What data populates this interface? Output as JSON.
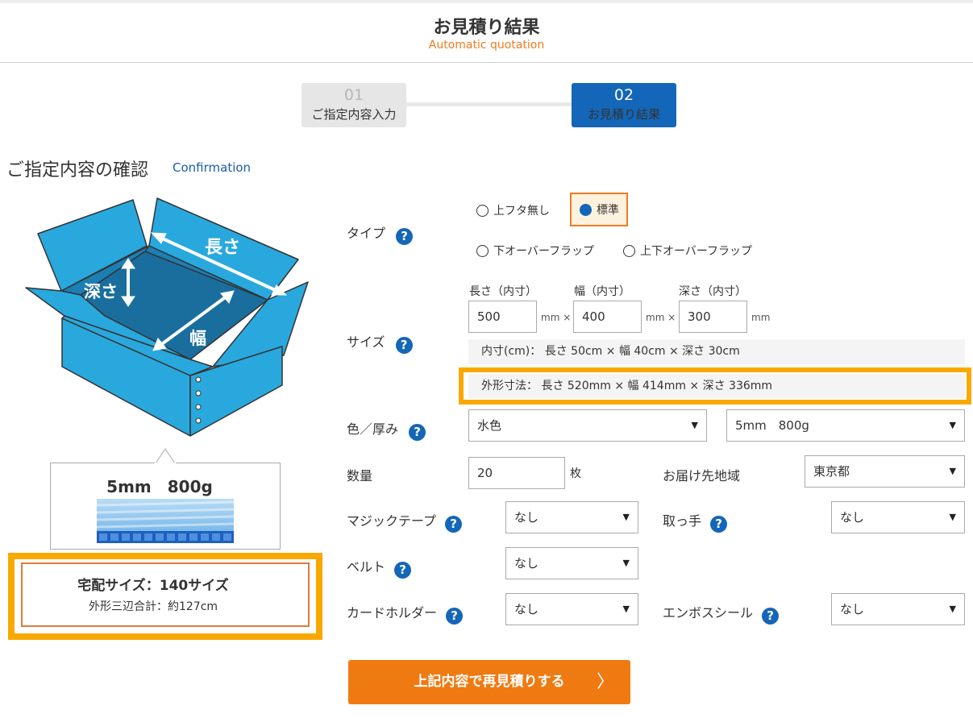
{
  "header": {
    "title": "お見積り結果",
    "subtitle": "Automatic quotation"
  },
  "steps": [
    {
      "num": "01",
      "label": "ご指定内容入力",
      "active": false
    },
    {
      "num": "02",
      "label": "お見積り結果",
      "active": true
    }
  ],
  "section": {
    "title": "ご指定内容の確認",
    "subtitle": "Confirmation"
  },
  "illustration": {
    "length": "長さ",
    "depth": "深さ",
    "width": "幅"
  },
  "material": {
    "title": "5mm　800g"
  },
  "delivery": {
    "size": "宅配サイズ：140サイズ",
    "sum": "外形三辺合計：約127cm"
  },
  "type": {
    "label": "タイプ",
    "options": {
      "no_lid": "上フタ無し",
      "standard": "標準",
      "lower_flap": "下オーバーフラップ",
      "both_flap": "上下オーバーフラップ"
    },
    "selected": "標準"
  },
  "size": {
    "label": "サイズ",
    "length_head": "長さ（内寸）",
    "width_head": "幅（内寸）",
    "depth_head": "深さ（内寸）",
    "length": "500",
    "width": "400",
    "depth": "300",
    "unit_mmx": "mm ×",
    "unit_mm": "mm",
    "inner": "内寸(cm)：  長さ 50cm × 幅 40cm × 深さ 30cm",
    "outer": "外形寸法：  長さ 520mm × 幅 414mm × 深さ 336mm"
  },
  "color": {
    "label": "色／厚み",
    "color_value": "水色",
    "thickness_value": "5mm　800g"
  },
  "quantity": {
    "label": "数量",
    "value": "20",
    "unit": "枚"
  },
  "region": {
    "label": "お届け先地域",
    "value": "東京都"
  },
  "magic_tape": {
    "label": "マジックテープ",
    "value": "なし"
  },
  "handle": {
    "label": "取っ手",
    "value": "なし"
  },
  "belt": {
    "label": "ベルト",
    "value": "なし"
  },
  "card_holder": {
    "label": "カードホルダー",
    "value": "なし"
  },
  "emboss": {
    "label": "エンボスシール",
    "value": "なし"
  },
  "help_icon_text": "?",
  "dropdown_glyph": "▼",
  "cta": {
    "label": "上記内容で再見積りする",
    "chevron": "〉"
  },
  "colors": {
    "accent_orange": "#f07a22",
    "primary_blue": "#1466b8",
    "highlight_yellow": "#f9a800",
    "box_blue": "#29a8dd"
  }
}
